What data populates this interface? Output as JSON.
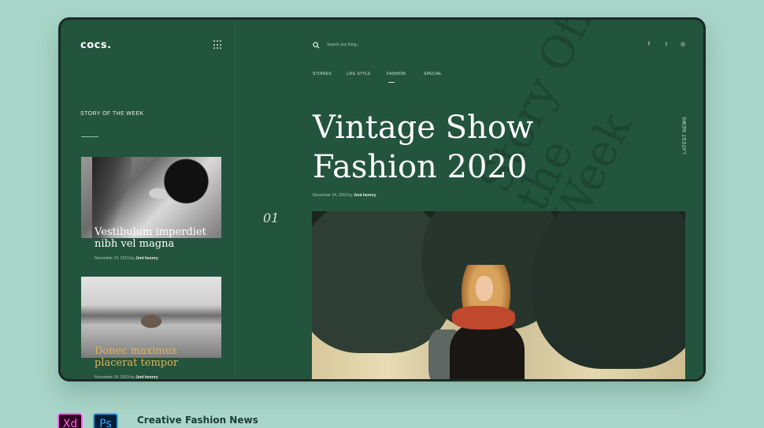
{
  "app": {
    "logo": "cocs.",
    "search_placeholder": "Search any thing...",
    "social": [
      "f",
      "t",
      "◎"
    ],
    "social_icons": [
      "facebook-icon",
      "twitter-icon",
      "instagram-icon"
    ]
  },
  "nav": {
    "items": [
      "STORIES",
      "LIFE STYLE",
      "FASHION",
      "SPECIAL"
    ],
    "active": "FASHION"
  },
  "sidebar": {
    "heading": "STORY OF THE WEEK",
    "cards": [
      {
        "title": "Vestibulum imperdiet nibh vel magna",
        "date": "November 24, 2019 by",
        "author": "Jont hennry"
      },
      {
        "title": "Donec maximus placerat tempor",
        "date": "November 24, 2019 by",
        "author": "Jont hennry"
      }
    ]
  },
  "hero": {
    "slide_number": "01",
    "title": "Vintage Show Fashion 2020",
    "date": "November 24, 2019 by",
    "author": "Jont hennry",
    "background_text": "Story Off the Week",
    "side_label": "LATEST NEWS"
  },
  "footer": {
    "xd_label": "Xd",
    "ps_label": "Ps",
    "title": "Creative Fashion News"
  },
  "colors": {
    "background": "#a9d6c9",
    "panel": "#23543d",
    "accent_gold": "#e0b45a"
  }
}
